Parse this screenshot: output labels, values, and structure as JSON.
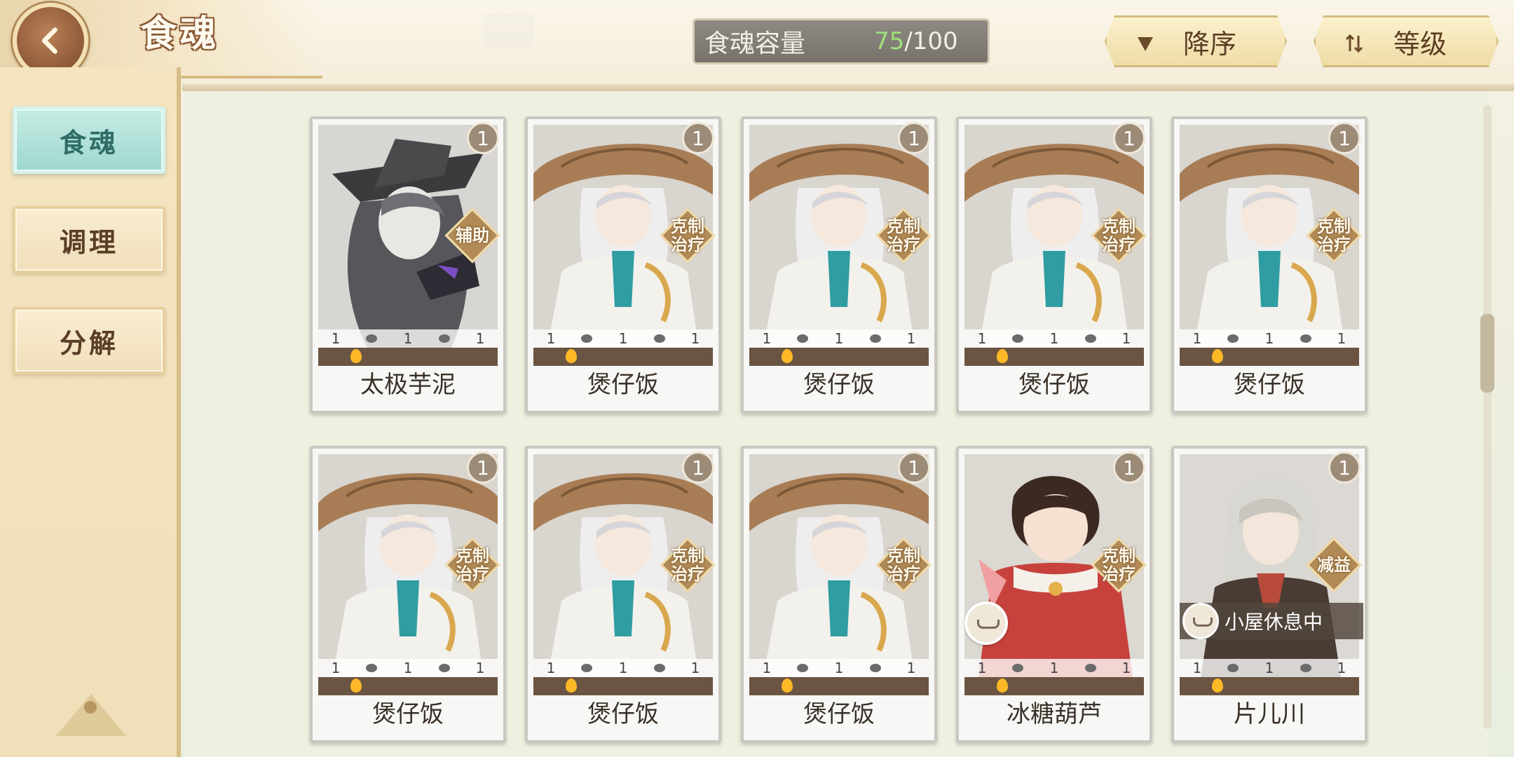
{
  "header": {
    "title": "食魂",
    "capacity_label": "食魂容量",
    "capacity_current": "75",
    "capacity_max": "/100",
    "sort_order_label": "降序",
    "sort_key_label": "等级"
  },
  "sidebar": {
    "items": [
      {
        "label": "食魂",
        "active": true
      },
      {
        "label": "调理",
        "active": false
      },
      {
        "label": "分解",
        "active": false
      }
    ]
  },
  "cards": [
    {
      "name": "太极芋泥",
      "level": "1",
      "role_line1": "辅助",
      "role_line2": "",
      "stat_a": "1",
      "stat_b": "1",
      "stat_c": "1",
      "status": "",
      "variant": "dark-hat"
    },
    {
      "name": "煲仔饭",
      "level": "1",
      "role_line1": "克制",
      "role_line2": "治疗",
      "stat_a": "1",
      "stat_b": "1",
      "stat_c": "1",
      "status": "",
      "variant": "straw-hat"
    },
    {
      "name": "煲仔饭",
      "level": "1",
      "role_line1": "克制",
      "role_line2": "治疗",
      "stat_a": "1",
      "stat_b": "1",
      "stat_c": "1",
      "status": "",
      "variant": "straw-hat"
    },
    {
      "name": "煲仔饭",
      "level": "1",
      "role_line1": "克制",
      "role_line2": "治疗",
      "stat_a": "1",
      "stat_b": "1",
      "stat_c": "1",
      "status": "",
      "variant": "straw-hat"
    },
    {
      "name": "煲仔饭",
      "level": "1",
      "role_line1": "克制",
      "role_line2": "治疗",
      "stat_a": "1",
      "stat_b": "1",
      "stat_c": "1",
      "status": "",
      "variant": "straw-hat"
    },
    {
      "name": "煲仔饭",
      "level": "1",
      "role_line1": "克制",
      "role_line2": "治疗",
      "stat_a": "1",
      "stat_b": "1",
      "stat_c": "1",
      "status": "",
      "variant": "straw-hat"
    },
    {
      "name": "煲仔饭",
      "level": "1",
      "role_line1": "克制",
      "role_line2": "治疗",
      "stat_a": "1",
      "stat_b": "1",
      "stat_c": "1",
      "status": "",
      "variant": "straw-hat"
    },
    {
      "name": "煲仔饭",
      "level": "1",
      "role_line1": "克制",
      "role_line2": "治疗",
      "stat_a": "1",
      "stat_b": "1",
      "stat_c": "1",
      "status": "",
      "variant": "straw-hat"
    },
    {
      "name": "冰糖葫芦",
      "level": "1",
      "role_line1": "克制",
      "role_line2": "治疗",
      "stat_a": "1",
      "stat_b": "1",
      "stat_c": "1",
      "status": "",
      "variant": "red-robe",
      "resting_icon": true
    },
    {
      "name": "片儿川",
      "level": "1",
      "role_line1": "减益",
      "role_line2": "",
      "stat_a": "1",
      "stat_b": "1",
      "stat_c": "1",
      "status": "小屋休息中",
      "variant": "silver-hair"
    }
  ],
  "colors": {
    "accent_teal": "#9ed7ce",
    "gold": "#b28a55",
    "capacity_current": "#9ee07a"
  }
}
